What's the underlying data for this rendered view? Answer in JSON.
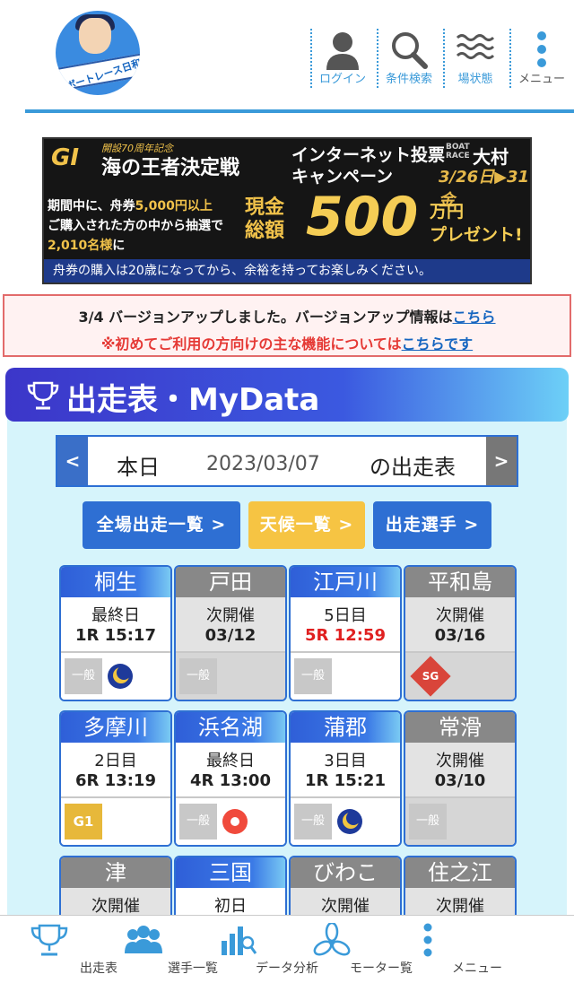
{
  "header": {
    "logo_text": "ボートレース日和",
    "nav": [
      {
        "label": "ログイン",
        "icon": "user-icon"
      },
      {
        "label": "条件検索",
        "icon": "search-icon"
      },
      {
        "label": "場状態",
        "icon": "waves-icon"
      },
      {
        "label": "メニュー",
        "icon": "dots-vertical-icon"
      }
    ]
  },
  "banner": {
    "grade": "GI",
    "anniv": "開設70周年記念",
    "title": "海の王者決定戦",
    "campaign": "インターネット投票\nキャンペーン",
    "boat_race": "BOAT\nRACE",
    "venue": "大村",
    "dates": "3/26日▶31金",
    "desc_1": "期間中に、舟券",
    "desc_2": "5,000円以上",
    "desc_3": "ご購入された方の中から抽選で",
    "desc_4": "2,010名様",
    "desc_5": "に",
    "prize_label": "現金\n総額",
    "prize_amount": "500",
    "prize_unit": "万円\nプレゼント!",
    "footer": "舟券の購入は20歳になってから、余裕を持ってお楽しみください。"
  },
  "notice": {
    "line1_text": "3/4 バージョンアップしました。バージョンアップ情報は",
    "line1_link": "こちら",
    "line2_text": "※初めてご利用の方向けの主な機能については",
    "line2_link": "こちらです"
  },
  "section": {
    "title": "出走表・MyData"
  },
  "datebar": {
    "prev": "<",
    "next": ">",
    "today": "本日",
    "date": "2023/03/07",
    "suffix": "の出走表"
  },
  "buttons": {
    "all": "全場出走一覧 >",
    "weather": "天候一覧 >",
    "racers": "出走選手 >"
  },
  "venues": [
    {
      "name": "桐生",
      "day": "最終日",
      "time": "1R 15:17",
      "grade": "一般",
      "extra": "moon",
      "active": true
    },
    {
      "name": "戸田",
      "day": "次開催",
      "time": "03/12",
      "grade": "一般",
      "extra": "",
      "active": false
    },
    {
      "name": "江戸川",
      "day": "5日目",
      "time": "5R 12:59",
      "grade": "一般",
      "extra": "",
      "active": true,
      "red": true
    },
    {
      "name": "平和島",
      "day": "次開催",
      "time": "03/16",
      "grade": "SG",
      "extra": "",
      "active": false
    },
    {
      "name": "多摩川",
      "day": "2日目",
      "time": "6R 13:19",
      "grade": "G1",
      "extra": "",
      "active": true
    },
    {
      "name": "浜名湖",
      "day": "最終日",
      "time": "4R 13:00",
      "grade": "一般",
      "extra": "sun",
      "active": true
    },
    {
      "name": "蒲郡",
      "day": "3日目",
      "time": "1R 15:21",
      "grade": "一般",
      "extra": "moon",
      "active": true
    },
    {
      "name": "常滑",
      "day": "次開催",
      "time": "03/10",
      "grade": "一般",
      "extra": "",
      "active": false
    },
    {
      "name": "津",
      "day": "次開催",
      "time": "",
      "grade": "",
      "extra": "",
      "active": false
    },
    {
      "name": "三国",
      "day": "初日",
      "time": "",
      "grade": "",
      "extra": "",
      "active": true
    },
    {
      "name": "びわこ",
      "day": "次開催",
      "time": "",
      "grade": "",
      "extra": "",
      "active": false
    },
    {
      "name": "住之江",
      "day": "次開催",
      "time": "",
      "grade": "",
      "extra": "",
      "active": false
    }
  ],
  "bottom_nav": [
    {
      "label": "出走表",
      "icon": "trophy-icon"
    },
    {
      "label": "選手一覧",
      "icon": "people-icon"
    },
    {
      "label": "データ分析",
      "icon": "chart-icon"
    },
    {
      "label": "モーター覧",
      "icon": "propeller-icon"
    },
    {
      "label": "メニュー",
      "icon": "dots-vertical-icon"
    }
  ]
}
